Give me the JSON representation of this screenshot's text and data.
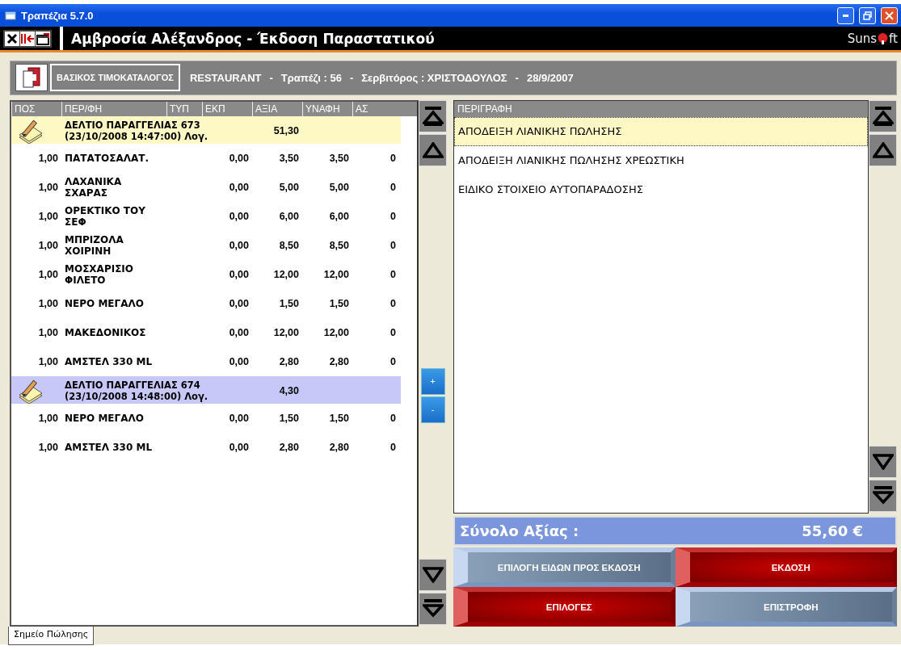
{
  "window": {
    "title": "Τραπέζια 5.7.0"
  },
  "header": {
    "title": "Αμβροσία Αλέξανδρος - Έκδοση Παραστατικού",
    "logo_parts": [
      "Suns",
      "ft"
    ]
  },
  "info_bar": {
    "price_list_button": "ΒΑΣΙΚΟΣ ΤΙΜΟΚΑΤΑΛΟΓΟΣ",
    "segments": [
      "RESTAURANT",
      "-",
      "Τραπέζι : 56",
      "-",
      "Σερβιτόρος : ΧΡΙΣΤΟΔΟΥΛΟΣ",
      "-",
      "28/9/2007"
    ]
  },
  "order_table": {
    "columns": [
      "ΠΟΣ",
      "ΠΕΡ/ΦΗ",
      "ΤΥΠ",
      "ΕΚΠ",
      "ΑΞΙΑ",
      "ΥΝΑΦΗ",
      "ΑΣ"
    ],
    "rows": [
      {
        "kind": "order",
        "selected": false,
        "title": "ΔΕΛΤΙΟ ΠΑΡΑΓΓΕΛΙΑΣ 673",
        "subtitle": "(23/10/2008 14:47:00) Λογ.",
        "value": "51,30"
      },
      {
        "kind": "item",
        "qty": "1,00",
        "name": "ΠΑΤΑΤΟΣΑΛΑΤ.",
        "discount": "0,00",
        "value": "3,50",
        "total": "3,50",
        "column_7": "0"
      },
      {
        "kind": "item",
        "qty": "1,00",
        "name": "ΛΑΧΑΝΙΚΑ ΣΧΑΡΑΣ",
        "discount": "0,00",
        "value": "5,00",
        "total": "5,00",
        "column_7": "0"
      },
      {
        "kind": "item",
        "qty": "1,00",
        "name": "ΟΡΕΚΤΙΚΟ ΤΟΥ ΣΕΦ",
        "discount": "0,00",
        "value": "6,00",
        "total": "6,00",
        "column_7": "0"
      },
      {
        "kind": "item",
        "qty": "1,00",
        "name": "ΜΠΡΙΖΟΛΑ ΧΟΙΡΙΝΗ",
        "discount": "0,00",
        "value": "8,50",
        "total": "8,50",
        "column_7": "0"
      },
      {
        "kind": "item",
        "qty": "1,00",
        "name": "ΜΟΣΧΑΡΙΣΙΟ ΦΙΛΕΤΟ",
        "discount": "0,00",
        "value": "12,00",
        "total": "12,00",
        "column_7": "0"
      },
      {
        "kind": "item",
        "qty": "1,00",
        "name": "ΝΕΡΟ ΜΕΓΑΛΟ",
        "discount": "0,00",
        "value": "1,50",
        "total": "1,50",
        "column_7": "0"
      },
      {
        "kind": "item",
        "qty": "1,00",
        "name": "ΜΑΚΕΔΟΝΙΚΟΣ",
        "discount": "0,00",
        "value": "12,00",
        "total": "12,00",
        "column_7": "0"
      },
      {
        "kind": "item",
        "qty": "1,00",
        "name": "ΑΜΣΤΕΛ 330 ML",
        "discount": "0,00",
        "value": "2,80",
        "total": "2,80",
        "column_7": "0"
      },
      {
        "kind": "order",
        "selected": true,
        "title": "ΔΕΛΤΙΟ ΠΑΡΑΓΓΕΛΙΑΣ 674",
        "subtitle": "(23/10/2008 14:48:00) Λογ.",
        "value": "4,30"
      },
      {
        "kind": "item",
        "qty": "1,00",
        "name": "ΝΕΡΟ ΜΕΓΑΛΟ",
        "discount": "0,00",
        "value": "1,50",
        "total": "1,50",
        "column_7": "0"
      },
      {
        "kind": "item",
        "qty": "1,00",
        "name": "ΑΜΣΤΕΛ 330 ML",
        "discount": "0,00",
        "value": "2,80",
        "total": "2,80",
        "column_7": "0"
      }
    ]
  },
  "quantity_buttons": [
    "+",
    "-"
  ],
  "document_list": {
    "column": "ΠΕΡΙΓΡΑΦΗ",
    "items": [
      {
        "label": "ΑΠΟΔΕΙΞΗ ΛΙΑΝΙΚΗΣ ΠΩΛΗΣΗΣ",
        "selected": true
      },
      {
        "label": "ΑΠΟΔΕΙΞΗ ΛΙΑΝΙΚΗΣ ΠΩΛΗΣΗΣ ΧΡΕΩΣΤΙΚΗ",
        "selected": false
      },
      {
        "label": "ΕΙΔΙΚΟ ΣΤΟΙΧΕΙΟ ΑΥΤΟΠΑΡΑΔΟΣΗΣ",
        "selected": false
      }
    ]
  },
  "total": {
    "label": "Σύνολο Αξίας :",
    "amount": "55,60 €"
  },
  "actions": [
    {
      "label": "ΕΠΙΛΟΓΗ ΕΙΔΩΝ ΠΡΟΣ ΕΚΔΟΣΗ",
      "kind": "steel"
    },
    {
      "label": "ΕΚΔΟΣΗ",
      "kind": "red"
    },
    {
      "label": "ΕΠΙΛΟΓΕΣ",
      "kind": "red"
    },
    {
      "label": "ΕΠΙΣΤΡΟΦΗ",
      "kind": "steel"
    }
  ],
  "tabs": [
    {
      "label": "Σημείο Πώλησης",
      "selected": true
    }
  ]
}
